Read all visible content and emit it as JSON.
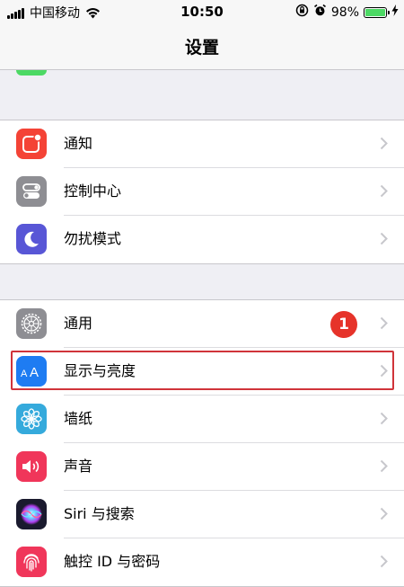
{
  "status_bar": {
    "carrier": "中国移动",
    "time": "10:50",
    "battery_percent": "98%",
    "battery_level": 0.98,
    "battery_color": "#4cd964"
  },
  "nav": {
    "title": "设置"
  },
  "groups": [
    {
      "items": [
        {
          "label": "通知",
          "icon": "notification-icon",
          "icon_color": "#f44336",
          "chevron": "chevron-right-icon"
        },
        {
          "label": "控制中心",
          "icon": "control-center-icon",
          "icon_color": "#8e8e93",
          "chevron": "chevron-right-icon"
        },
        {
          "label": "勿扰模式",
          "icon": "moon-icon",
          "icon_color": "#5856d6",
          "chevron": "chevron-right-icon"
        }
      ]
    },
    {
      "items": [
        {
          "label": "通用",
          "icon": "gear-icon",
          "icon_color": "#8e8e93",
          "badge": "1",
          "badge_color": "#e6332a",
          "chevron": "chevron-right-icon"
        },
        {
          "label": "显示与亮度",
          "icon": "display-brightness-icon",
          "icon_glyph": "AA",
          "icon_color": "#1e7cf2",
          "chevron": "chevron-right-icon",
          "highlighted": true,
          "highlight_color": "#d0343a"
        },
        {
          "label": "墙纸",
          "icon": "wallpaper-flower-icon",
          "icon_color": "#35aadc",
          "chevron": "chevron-right-icon"
        },
        {
          "label": "声音",
          "icon": "speaker-icon",
          "icon_color": "#f0365a",
          "chevron": "chevron-right-icon"
        },
        {
          "label": "Siri 与搜索",
          "icon": "siri-icon",
          "icon_color": "#1a1a2e",
          "chevron": "chevron-right-icon"
        },
        {
          "label": "触控 ID 与密码",
          "icon": "fingerprint-icon",
          "icon_color": "#f0365a",
          "chevron": "chevron-right-icon"
        }
      ]
    }
  ]
}
